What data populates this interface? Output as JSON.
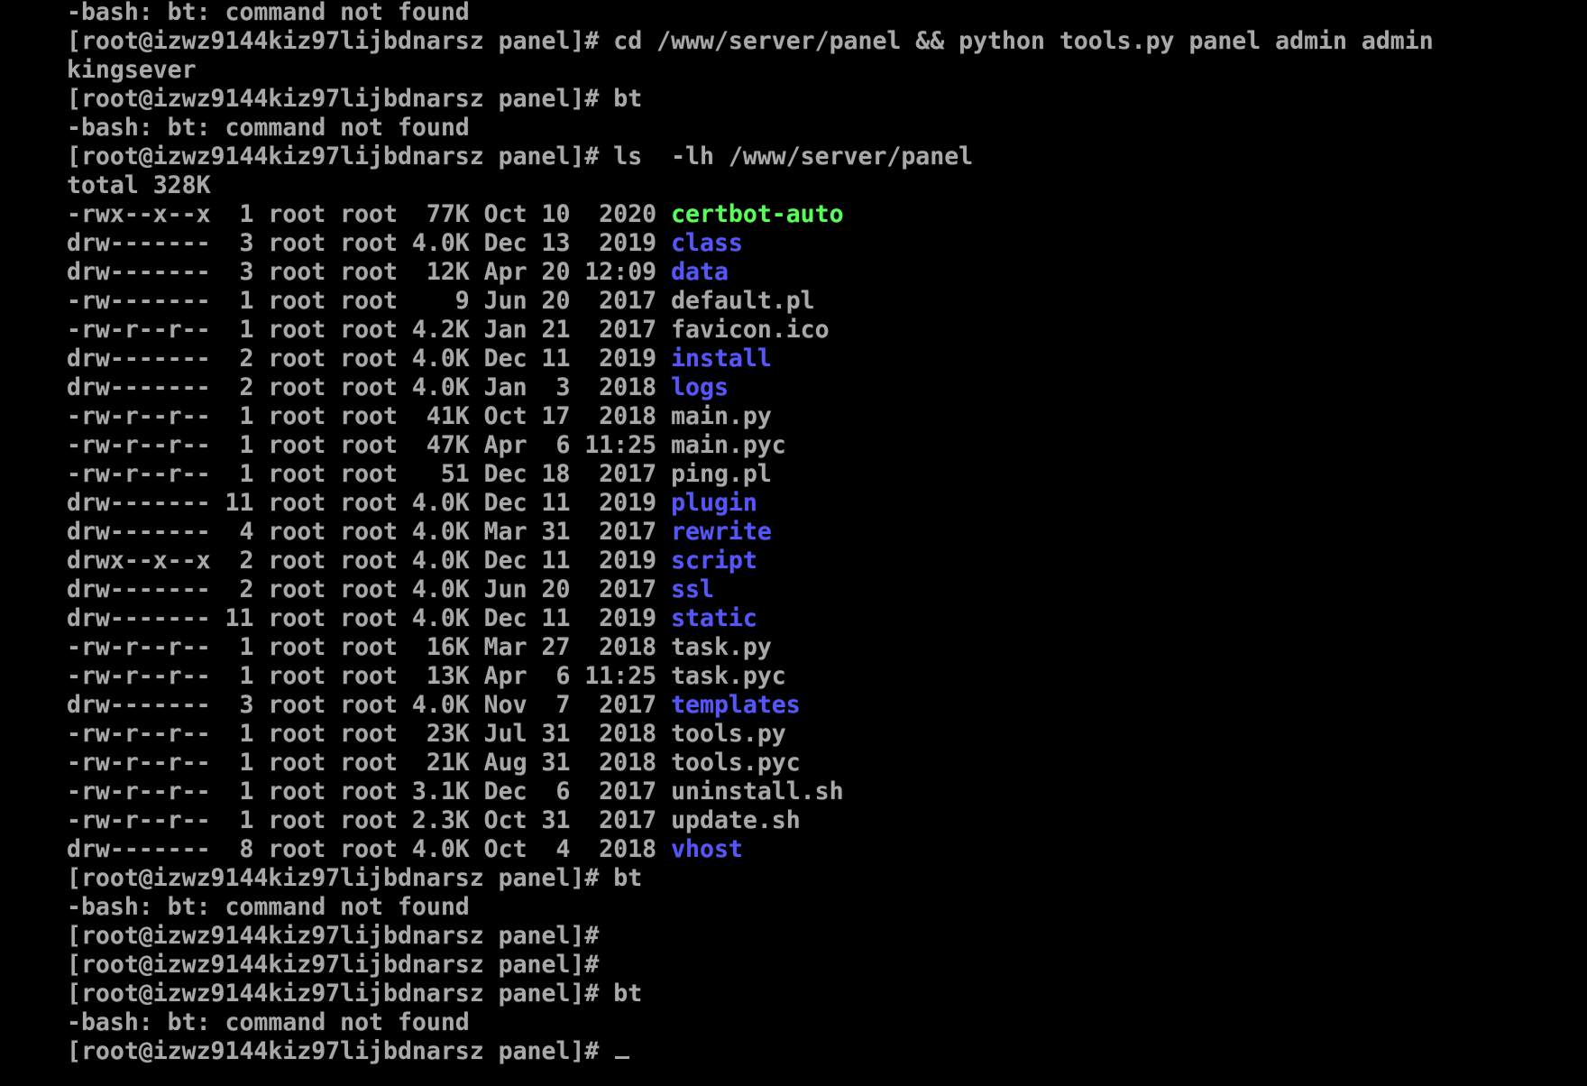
{
  "colors": {
    "background": "#000000",
    "text": "#a8a8a8",
    "executable": "#55ff55",
    "directory": "#5555ff"
  },
  "prompt": "[root@izwz9144kiz97lijbdnarsz panel]# ",
  "lines": [
    {
      "kind": "output",
      "text": "-bash: bt: command not found"
    },
    {
      "kind": "prompt",
      "cmd": "cd /www/server/panel && python tools.py panel admin admin"
    },
    {
      "kind": "output",
      "text": "kingsever"
    },
    {
      "kind": "prompt",
      "cmd": "bt"
    },
    {
      "kind": "output",
      "text": "-bash: bt: command not found"
    },
    {
      "kind": "prompt",
      "cmd": "ls  -lh /www/server/panel"
    },
    {
      "kind": "output",
      "text": "total 328K"
    },
    {
      "kind": "ls",
      "meta": "-rwx--x--x  1 root root  77K Oct 10  2020 ",
      "name": "certbot-auto",
      "type": "exec"
    },
    {
      "kind": "ls",
      "meta": "drw-------  3 root root 4.0K Dec 13  2019 ",
      "name": "class",
      "type": "dir"
    },
    {
      "kind": "ls",
      "meta": "drw-------  3 root root  12K Apr 20 12:09 ",
      "name": "data",
      "type": "dir"
    },
    {
      "kind": "ls",
      "meta": "-rw-------  1 root root    9 Jun 20  2017 ",
      "name": "default.pl",
      "type": "file"
    },
    {
      "kind": "ls",
      "meta": "-rw-r--r--  1 root root 4.2K Jan 21  2017 ",
      "name": "favicon.ico",
      "type": "file"
    },
    {
      "kind": "ls",
      "meta": "drw-------  2 root root 4.0K Dec 11  2019 ",
      "name": "install",
      "type": "dir"
    },
    {
      "kind": "ls",
      "meta": "drw-------  2 root root 4.0K Jan  3  2018 ",
      "name": "logs",
      "type": "dir"
    },
    {
      "kind": "ls",
      "meta": "-rw-r--r--  1 root root  41K Oct 17  2018 ",
      "name": "main.py",
      "type": "file"
    },
    {
      "kind": "ls",
      "meta": "-rw-r--r--  1 root root  47K Apr  6 11:25 ",
      "name": "main.pyc",
      "type": "file"
    },
    {
      "kind": "ls",
      "meta": "-rw-r--r--  1 root root   51 Dec 18  2017 ",
      "name": "ping.pl",
      "type": "file"
    },
    {
      "kind": "ls",
      "meta": "drw------- 11 root root 4.0K Dec 11  2019 ",
      "name": "plugin",
      "type": "dir"
    },
    {
      "kind": "ls",
      "meta": "drw-------  4 root root 4.0K Mar 31  2017 ",
      "name": "rewrite",
      "type": "dir"
    },
    {
      "kind": "ls",
      "meta": "drwx--x--x  2 root root 4.0K Dec 11  2019 ",
      "name": "script",
      "type": "dir"
    },
    {
      "kind": "ls",
      "meta": "drw-------  2 root root 4.0K Jun 20  2017 ",
      "name": "ssl",
      "type": "dir"
    },
    {
      "kind": "ls",
      "meta": "drw------- 11 root root 4.0K Dec 11  2019 ",
      "name": "static",
      "type": "dir"
    },
    {
      "kind": "ls",
      "meta": "-rw-r--r--  1 root root  16K Mar 27  2018 ",
      "name": "task.py",
      "type": "file"
    },
    {
      "kind": "ls",
      "meta": "-rw-r--r--  1 root root  13K Apr  6 11:25 ",
      "name": "task.pyc",
      "type": "file"
    },
    {
      "kind": "ls",
      "meta": "drw-------  3 root root 4.0K Nov  7  2017 ",
      "name": "templates",
      "type": "dir"
    },
    {
      "kind": "ls",
      "meta": "-rw-r--r--  1 root root  23K Jul 31  2018 ",
      "name": "tools.py",
      "type": "file"
    },
    {
      "kind": "ls",
      "meta": "-rw-r--r--  1 root root  21K Aug 31  2018 ",
      "name": "tools.pyc",
      "type": "file"
    },
    {
      "kind": "ls",
      "meta": "-rw-r--r--  1 root root 3.1K Dec  6  2017 ",
      "name": "uninstall.sh",
      "type": "file"
    },
    {
      "kind": "ls",
      "meta": "-rw-r--r--  1 root root 2.3K Oct 31  2017 ",
      "name": "update.sh",
      "type": "file"
    },
    {
      "kind": "ls",
      "meta": "drw-------  8 root root 4.0K Oct  4  2018 ",
      "name": "vhost",
      "type": "dir"
    },
    {
      "kind": "prompt",
      "cmd": "bt"
    },
    {
      "kind": "output",
      "text": "-bash: bt: command not found"
    },
    {
      "kind": "prompt",
      "cmd": ""
    },
    {
      "kind": "prompt",
      "cmd": ""
    },
    {
      "kind": "prompt",
      "cmd": "bt"
    },
    {
      "kind": "output",
      "text": "-bash: bt: command not found"
    },
    {
      "kind": "prompt",
      "cmd": "",
      "cursor": true
    }
  ]
}
